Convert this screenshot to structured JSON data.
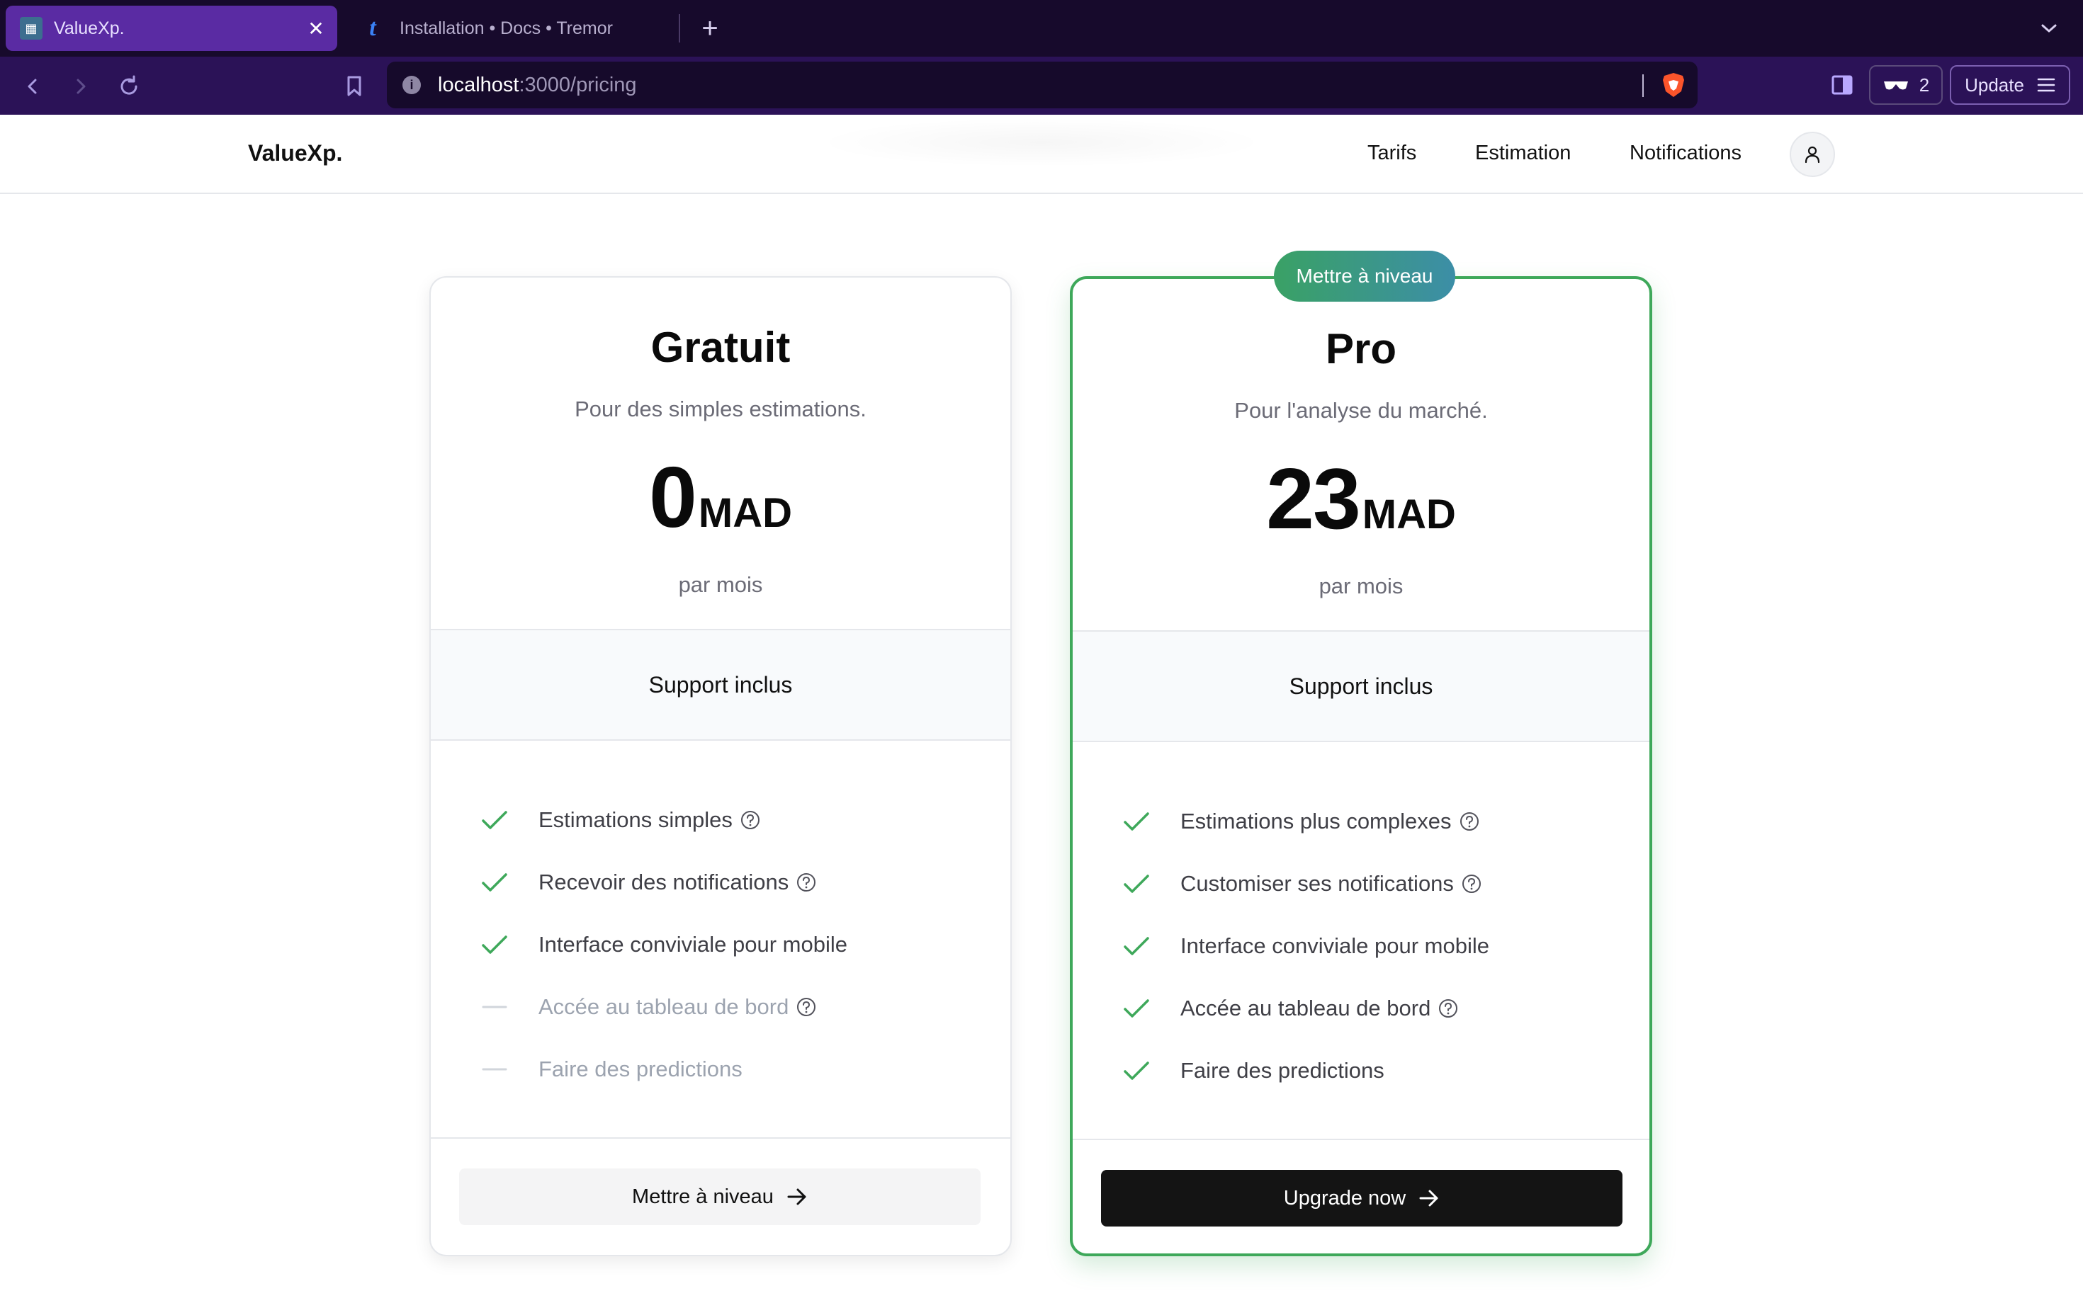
{
  "browser": {
    "tabs": [
      {
        "title": "ValueXp.",
        "active": true
      },
      {
        "title": "Installation • Docs • Tremor",
        "active": false
      }
    ],
    "url": {
      "host": "localhost",
      "path": ":3000/pricing"
    },
    "shields_count": "2",
    "update_label": "Update"
  },
  "header": {
    "brand": "ValueXp.",
    "nav": [
      "Tarifs",
      "Estimation",
      "Notifications"
    ]
  },
  "plans": [
    {
      "name": "Gratuit",
      "subtitle": "Pour des simples estimations.",
      "price": "0",
      "currency": "MAD",
      "period": "par mois",
      "support": "Support inclus",
      "features": [
        {
          "label": "Estimations simples",
          "included": true,
          "help": true
        },
        {
          "label": "Recevoir des notifications",
          "included": true,
          "help": true
        },
        {
          "label": "Interface conviviale pour mobile",
          "included": true,
          "help": false
        },
        {
          "label": "Accée au tableau de bord",
          "included": false,
          "help": true
        },
        {
          "label": "Faire des predictions",
          "included": false,
          "help": false
        }
      ],
      "cta": "Mettre à niveau"
    },
    {
      "badge": "Mettre à niveau",
      "name": "Pro",
      "subtitle": "Pour l'analyse du marché.",
      "price": "23",
      "currency": "MAD",
      "period": "par mois",
      "support": "Support inclus",
      "features": [
        {
          "label": "Estimations plus complexes",
          "included": true,
          "help": true
        },
        {
          "label": "Customiser ses notifications",
          "included": true,
          "help": true
        },
        {
          "label": "Interface conviviale pour mobile",
          "included": true,
          "help": false
        },
        {
          "label": "Accée au tableau de bord",
          "included": true,
          "help": true
        },
        {
          "label": "Faire des predictions",
          "included": true,
          "help": false
        }
      ],
      "cta": "Upgrade now"
    }
  ],
  "colors": {
    "accent_green": "#3ea85a",
    "cta_dark": "#141414",
    "tab_active": "#5a2ba3",
    "toolbar": "#2b1257"
  }
}
